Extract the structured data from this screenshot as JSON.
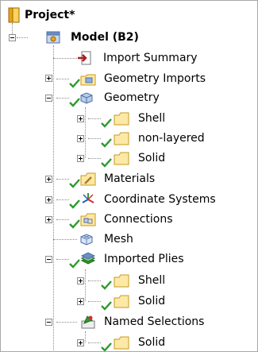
{
  "tree": {
    "root": {
      "label": "Project*",
      "icon": "project-icon"
    },
    "model": {
      "label": "Model (B2)",
      "icon": "model-icon"
    },
    "items": [
      {
        "label": "Import Summary",
        "icon": "import-arrow-icon"
      },
      {
        "label": "Geometry Imports",
        "icon": "geometry-imports-icon",
        "status": "ok"
      },
      {
        "label": "Geometry",
        "icon": "geometry-icon",
        "status": "ok"
      },
      {
        "label": "Shell",
        "icon": "folder-icon",
        "status": "ok"
      },
      {
        "label": "non-layered",
        "icon": "folder-icon",
        "status": "ok"
      },
      {
        "label": "Solid",
        "icon": "folder-icon",
        "status": "ok"
      },
      {
        "label": "Materials",
        "icon": "materials-icon",
        "status": "ok"
      },
      {
        "label": "Coordinate Systems",
        "icon": "coordinate-systems-icon",
        "status": "ok"
      },
      {
        "label": "Connections",
        "icon": "connections-icon",
        "status": "ok"
      },
      {
        "label": "Mesh",
        "icon": "mesh-icon"
      },
      {
        "label": "Imported Plies",
        "icon": "imported-plies-icon",
        "status": "ok"
      },
      {
        "label": "Shell",
        "icon": "folder-icon",
        "status": "ok"
      },
      {
        "label": "Solid",
        "icon": "folder-icon",
        "status": "ok"
      },
      {
        "label": "Named Selections",
        "icon": "named-selections-icon"
      },
      {
        "label": "Solid",
        "icon": "folder-icon",
        "status": "ok"
      }
    ]
  },
  "colors": {
    "folder_fill": "#fde9a6",
    "folder_stroke": "#c89a1f",
    "check_green": "#2e9a2e",
    "connector_dots": "#8c8c8c"
  }
}
